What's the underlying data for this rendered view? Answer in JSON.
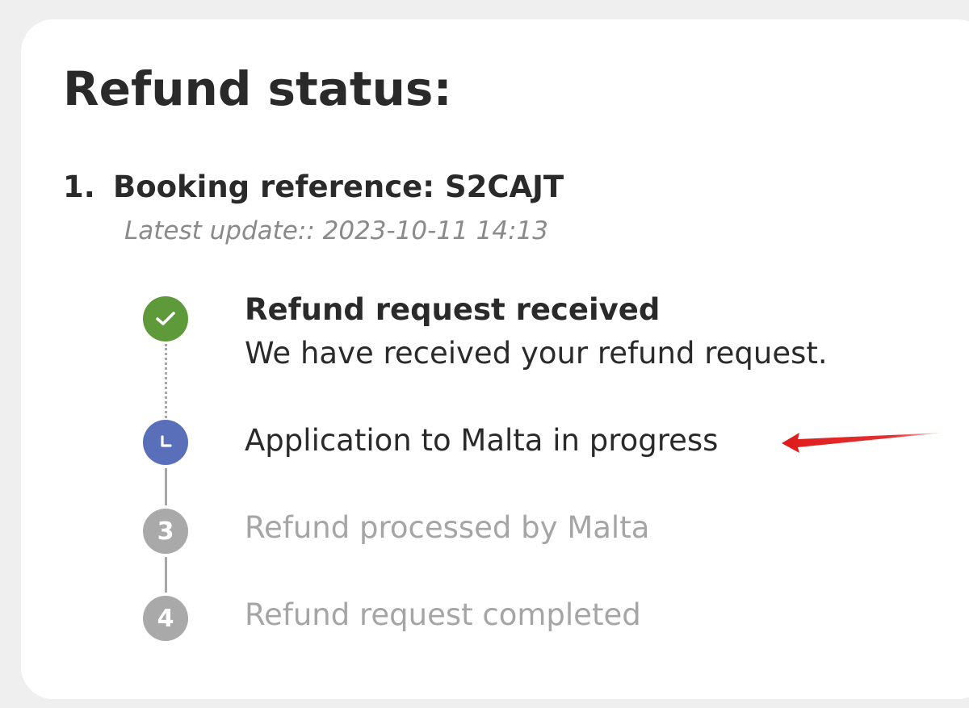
{
  "page": {
    "title": "Refund status:"
  },
  "booking": {
    "number": "1.",
    "reference": "Booking reference: S2CAJT",
    "latest_update": "Latest update:: 2023-10-11 14:13"
  },
  "steps": [
    {
      "label": "Refund request received",
      "description": "We have received your refund request.",
      "state": "completed",
      "icon": "check-icon",
      "color": "#5e9a3a"
    },
    {
      "label": "Application to Malta in progress",
      "state": "in-progress",
      "icon": "clock-icon",
      "color": "#5a6fb9"
    },
    {
      "label": "Refund processed by Malta",
      "state": "pending",
      "icon_text": "3",
      "color": "#a9a9a9"
    },
    {
      "label": "Refund request completed",
      "state": "pending",
      "icon_text": "4",
      "color": "#a9a9a9"
    }
  ],
  "annotation": {
    "icon": "red-arrow-icon",
    "color": "#e01b1b",
    "points_to": "Application to Malta in progress"
  }
}
